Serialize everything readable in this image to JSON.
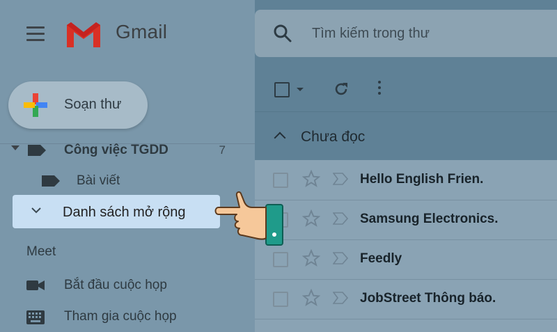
{
  "app": {
    "name": "Gmail"
  },
  "search": {
    "placeholder": "Tìm kiếm trong thư"
  },
  "compose": {
    "label": "Soạn thư"
  },
  "sidebar": {
    "labels": [
      {
        "name": "Công việc TGDD",
        "count": "7"
      },
      {
        "name": "Bài viết"
      }
    ],
    "expand": {
      "label": "Danh sách mở rộng"
    },
    "meet": {
      "title": "Meet",
      "items": [
        {
          "label": "Bắt đầu cuộc họp",
          "icon": "video-camera-icon"
        },
        {
          "label": "Tham gia cuộc họp",
          "icon": "keyboard-icon"
        }
      ]
    }
  },
  "main": {
    "section_title": "Chưa đọc",
    "emails": [
      {
        "sender": "Hello English Frien."
      },
      {
        "sender": "Samsung Electronics."
      },
      {
        "sender": "Feedly"
      },
      {
        "sender": "JobStreet Thông báo."
      }
    ]
  },
  "colors": {
    "sidebar_bg": "#7a97aa",
    "highlight": "#c8dff3",
    "gmail_red": "#ea4335"
  }
}
